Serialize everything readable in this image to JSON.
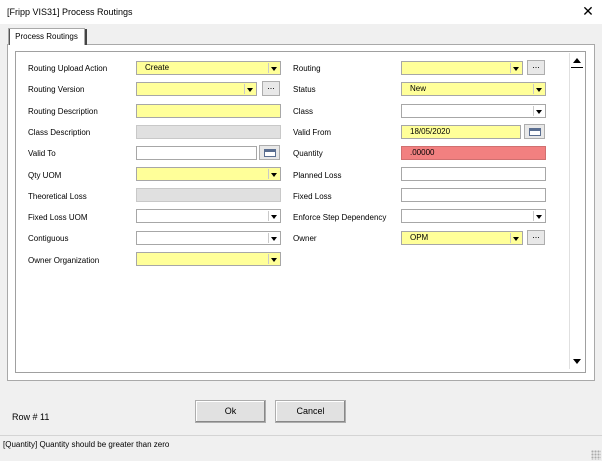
{
  "window": {
    "title": "[Fripp VIS31] Process Routings",
    "close_glyph": "✕"
  },
  "tab": {
    "label": "Process Routings"
  },
  "left_fields": [
    {
      "label": "Routing Upload Action",
      "value": "Create"
    },
    {
      "label": "Routing Version",
      "value": ""
    },
    {
      "label": "Routing Description",
      "value": ""
    },
    {
      "label": "Class Description",
      "value": ""
    },
    {
      "label": "Valid To",
      "value": ""
    },
    {
      "label": "Qty UOM",
      "value": ""
    },
    {
      "label": "Theoretical Loss",
      "value": ""
    },
    {
      "label": "Fixed Loss UOM",
      "value": ""
    },
    {
      "label": "Contiguous",
      "value": ""
    },
    {
      "label": "Owner Organization",
      "value": ""
    }
  ],
  "right_fields": [
    {
      "label": "Routing",
      "value": ""
    },
    {
      "label": "Status",
      "value": "New"
    },
    {
      "label": "Class",
      "value": ""
    },
    {
      "label": "Valid From",
      "value": "18/05/2020"
    },
    {
      "label": "Quantity",
      "value": ".00000"
    },
    {
      "label": "Planned Loss",
      "value": ""
    },
    {
      "label": "Fixed Loss",
      "value": ""
    },
    {
      "label": "Enforce Step Dependency",
      "value": ""
    },
    {
      "label": "Owner",
      "value": "OPM"
    }
  ],
  "ellipsis_label": "...",
  "buttons": {
    "ok": "Ok",
    "cancel": "Cancel"
  },
  "row_indicator": "Row # 11",
  "status_message": "[Quantity] Quantity should be greater than zero",
  "colors": {
    "required": "#ffff99",
    "error": "#f28080",
    "disabled": "#e0e0e0"
  }
}
